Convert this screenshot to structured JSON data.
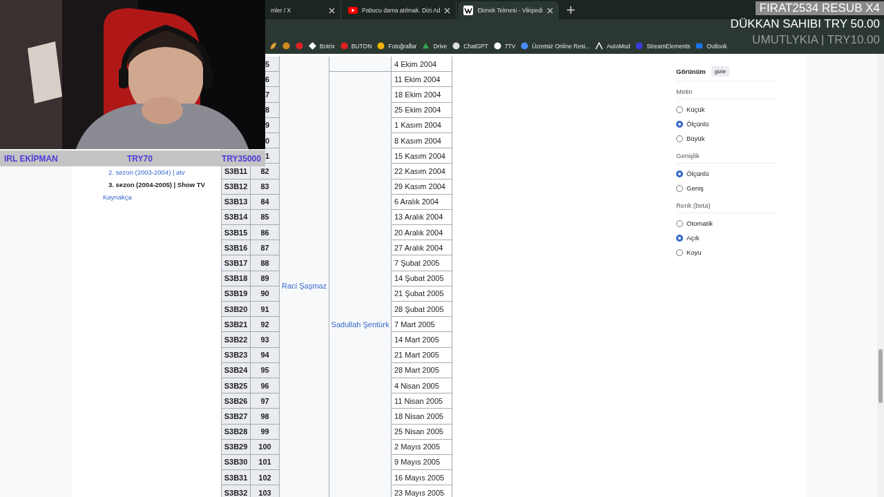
{
  "webcam": {
    "kind": "picture",
    "bar": [
      "IRL EKİPMAN",
      "TRY70",
      "TRY35000"
    ]
  },
  "tabs": [
    {
      "title": "mler / X",
      "selected": false,
      "kind": "plain"
    },
    {
      "title": "Pabucu dama atılmak. Dizi Ad",
      "selected": false,
      "kind": "video"
    },
    {
      "title": "Ekmek Teknesi - Vikipedi",
      "selected": true,
      "kind": "wiki"
    }
  ],
  "bookmarks": [
    {
      "kind": "leaf"
    },
    {
      "kind": "dot"
    },
    {
      "kind": "dot"
    },
    {
      "label": "Botrix",
      "kind": "diamond"
    },
    {
      "label": "BUTON",
      "kind": "dot"
    },
    {
      "label": "Fotoğraflar",
      "kind": "dot"
    },
    {
      "label": "Drive",
      "kind": "triangle"
    },
    {
      "label": "ChatGPT",
      "kind": "dot"
    },
    {
      "label": "7TV",
      "kind": "dot"
    },
    {
      "label": "Ücretsiz Online Resi...",
      "kind": "dot"
    },
    {
      "label": "AutoMod",
      "kind": "peak"
    },
    {
      "label": "StreamElements",
      "kind": "dot"
    },
    {
      "label": "Outlook",
      "kind": "mail"
    }
  ],
  "alerts": [
    {
      "text": "FIRAT2534  RESUB X4",
      "kind": "boxed"
    },
    {
      "text": "DÜKKAN SAHIBI  TRY 50.00",
      "kind": "plain"
    },
    {
      "text": "UMUTLYKIA | TRY10.00",
      "kind": "faded"
    }
  ],
  "sidebar": [
    {
      "label": "2. sezon (2003-2004) | atv",
      "kind": "sub",
      "current": false
    },
    {
      "label": "3. sezon (2004-2005) | Show TV",
      "kind": "sub",
      "current": true
    },
    {
      "label": "Kaynakça",
      "kind": "top",
      "current": false
    }
  ],
  "table": {
    "column_3": "Raci Şaşmaz",
    "column_4": "Sadullah Şentürk",
    "rows": [
      {
        "number": "5",
        "date": "4 Ekim 2004"
      },
      {
        "number": "6",
        "date": "11 Ekim 2004"
      },
      {
        "number": "7",
        "date": "18 Ekim 2004"
      },
      {
        "number": "8",
        "date": "25 Ekim 2004"
      },
      {
        "number": "9",
        "date": "1 Kasım 2004"
      },
      {
        "number": "0",
        "date": "8 Kasım 2004"
      },
      {
        "number": "1",
        "date": "15 Kasım 2004"
      },
      {
        "code": "S3B11",
        "number": "82",
        "date": "22 Kasım 2004"
      },
      {
        "code": "S3B12",
        "number": "83",
        "date": "29 Kasım 2004"
      },
      {
        "code": "S3B13",
        "number": "84",
        "date": "6 Aralık 2004"
      },
      {
        "code": "S3B14",
        "number": "85",
        "date": "13 Aralık 2004"
      },
      {
        "code": "S3B15",
        "number": "86",
        "date": "20 Aralık 2004"
      },
      {
        "code": "S3B16",
        "number": "87",
        "date": "27 Aralık 2004"
      },
      {
        "code": "S3B17",
        "number": "88",
        "date": "7 Şubat 2005"
      },
      {
        "code": "S3B18",
        "number": "89",
        "date": "14 Şubat 2005"
      },
      {
        "code": "S3B19",
        "number": "90",
        "date": "21 Şubat 2005"
      },
      {
        "code": "S3B20",
        "number": "91",
        "date": "28 Şubat 2005"
      },
      {
        "code": "S3B21",
        "number": "92",
        "date": "7 Mart 2005"
      },
      {
        "code": "S3B22",
        "number": "93",
        "date": "14 Mart 2005"
      },
      {
        "code": "S3B23",
        "number": "94",
        "date": "21 Mart 2005"
      },
      {
        "code": "S3B24",
        "number": "95",
        "date": "28 Mart 2005"
      },
      {
        "code": "S3B25",
        "number": "96",
        "date": "4 Nisan 2005"
      },
      {
        "code": "S3B26",
        "number": "97",
        "date": "11 Nisan 2005"
      },
      {
        "code": "S3B27",
        "number": "98",
        "date": "18 Nisan 2005"
      },
      {
        "code": "S3B28",
        "number": "99",
        "date": "25 Nisan 2005"
      },
      {
        "code": "S3B29",
        "number": "100",
        "date": "2 Mayıs 2005"
      },
      {
        "code": "S3B30",
        "number": "101",
        "date": "9 Mayıs 2005"
      },
      {
        "code": "S3B31",
        "number": "102",
        "date": "16 Mayıs 2005"
      },
      {
        "code": "S3B32",
        "number": "103",
        "date": "23 Mayıs 2005"
      }
    ]
  },
  "appearance": {
    "title": "Görünüm",
    "hide_button": "gizle",
    "groups": [
      {
        "label": "Metin",
        "options": [
          {
            "label": "Küçük",
            "selected": false
          },
          {
            "label": "Ölçünlü",
            "selected": true
          },
          {
            "label": "Büyük",
            "selected": false
          }
        ]
      },
      {
        "label": "Genişlik",
        "options": [
          {
            "label": "Ölçünlü",
            "selected": true
          },
          {
            "label": "Geniş",
            "selected": false
          }
        ]
      },
      {
        "label": "Renk (beta)",
        "options": [
          {
            "label": "Otomatik",
            "selected": false
          },
          {
            "label": "Açık",
            "selected": true
          },
          {
            "label": "Koyu",
            "selected": false
          }
        ]
      }
    ]
  }
}
